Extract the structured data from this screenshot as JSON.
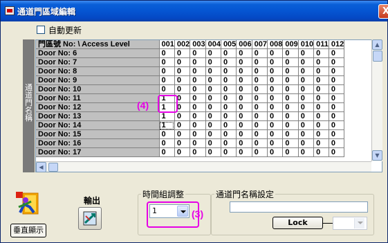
{
  "window": {
    "title": "通道門區域編輯",
    "close_glyph": "X"
  },
  "auto_update": {
    "label": "自動更新",
    "checked": false
  },
  "side_label": [
    "通",
    "道",
    "門",
    "名",
    "稱"
  ],
  "grid": {
    "header_label": "門區號 No:  \\    Access Level",
    "columns": [
      "001",
      "002",
      "003",
      "004",
      "005",
      "006",
      "007",
      "008",
      "009",
      "010",
      "011",
      "012"
    ],
    "rows": [
      {
        "label": "Door No: 6",
        "values": [
          "0",
          "0",
          "0",
          "0",
          "0",
          "0",
          "0",
          "0",
          "0",
          "0",
          "0",
          "0"
        ]
      },
      {
        "label": "Door No: 7",
        "values": [
          "0",
          "0",
          "0",
          "0",
          "0",
          "0",
          "0",
          "0",
          "0",
          "0",
          "0",
          "0"
        ]
      },
      {
        "label": "Door No: 8",
        "values": [
          "0",
          "0",
          "0",
          "0",
          "0",
          "0",
          "0",
          "0",
          "0",
          "0",
          "0",
          "0"
        ]
      },
      {
        "label": "Door No: 9",
        "values": [
          "0",
          "0",
          "0",
          "0",
          "0",
          "0",
          "0",
          "0",
          "0",
          "0",
          "0",
          "0"
        ]
      },
      {
        "label": "Door No: 10",
        "values": [
          "0",
          "0",
          "0",
          "0",
          "0",
          "0",
          "0",
          "0",
          "0",
          "0",
          "0",
          "0"
        ]
      },
      {
        "label": "Door No: 11",
        "values": [
          "1",
          "0",
          "0",
          "0",
          "0",
          "0",
          "0",
          "0",
          "0",
          "0",
          "0",
          "0"
        ]
      },
      {
        "label": "Door No: 12",
        "values": [
          "1",
          "0",
          "0",
          "0",
          "0",
          "0",
          "0",
          "0",
          "0",
          "0",
          "0",
          "0"
        ]
      },
      {
        "label": "Door No: 13",
        "values": [
          "1",
          "0",
          "0",
          "0",
          "0",
          "0",
          "0",
          "0",
          "0",
          "0",
          "0",
          "0"
        ]
      },
      {
        "label": "Door No: 14",
        "values": [
          "1",
          "0",
          "0",
          "0",
          "0",
          "0",
          "0",
          "0",
          "0",
          "0",
          "0",
          "0"
        ]
      },
      {
        "label": "Door No: 15",
        "values": [
          "0",
          "0",
          "0",
          "0",
          "0",
          "0",
          "0",
          "0",
          "0",
          "0",
          "0",
          "0"
        ]
      },
      {
        "label": "Door No: 16",
        "values": [
          "0",
          "0",
          "0",
          "0",
          "0",
          "0",
          "0",
          "0",
          "0",
          "0",
          "0",
          "0"
        ]
      },
      {
        "label": "Door No: 17",
        "values": [
          "0",
          "0",
          "0",
          "0",
          "0",
          "0",
          "0",
          "0",
          "0",
          "0",
          "0",
          "0"
        ]
      }
    ],
    "scroll_up_glyph": "▲",
    "scroll_down_glyph": "▼",
    "scroll_left_glyph": "◀"
  },
  "annotations": {
    "cell_marker": "(4)",
    "combo_marker": "(3)",
    "color": "#e600e6"
  },
  "vertical_display_button": "垂直顯示",
  "export": {
    "label": "輸出",
    "icon": "export-icon"
  },
  "time_group": {
    "legend": "時間組調整",
    "selected": "1"
  },
  "door_name": {
    "legend": "通道門名稱設定",
    "value": "",
    "lock_label": "Lock",
    "lock_select_value": ""
  },
  "colors": {
    "title_bar": "#0555d2",
    "row_header": "#c0c0c0",
    "side_label": "#7a7a7a",
    "annotation": "#e600e6"
  }
}
